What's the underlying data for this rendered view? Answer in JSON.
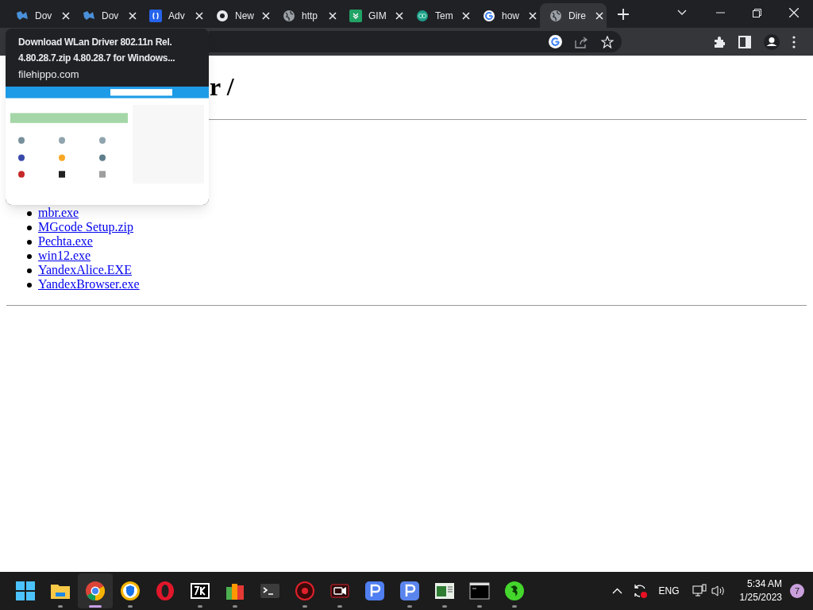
{
  "tabs": [
    {
      "title": "Dov",
      "selected": false
    },
    {
      "title": "Dov",
      "selected": false
    },
    {
      "title": "Adv",
      "selected": false
    },
    {
      "title": "New",
      "selected": false
    },
    {
      "title": "http",
      "selected": false
    },
    {
      "title": "GIM",
      "selected": false
    },
    {
      "title": "Tem",
      "selected": false
    },
    {
      "title": "how",
      "selected": false
    },
    {
      "title": "Dire",
      "selected": true
    }
  ],
  "tab_preview": {
    "title": "Download WLan Driver 802.11n Rel. 4.80.28.7.zip 4.80.28.7 for Windows...",
    "domain": "filehippo.com"
  },
  "page": {
    "heading": "r /",
    "files": [
      "mbr.exe",
      "MGcode Setup.zip",
      "Pechta.exe",
      "win12.exe",
      "YandexAlice.EXE",
      "YandexBrowser.exe"
    ]
  },
  "taskbar": {
    "apps": [
      {
        "running": false,
        "selected": false
      },
      {
        "running": true,
        "selected": false
      },
      {
        "running": true,
        "selected": true
      },
      {
        "running": true,
        "selected": false
      },
      {
        "running": false,
        "selected": false
      },
      {
        "running": true,
        "selected": false
      },
      {
        "running": true,
        "selected": false
      },
      {
        "running": false,
        "selected": false
      },
      {
        "running": true,
        "selected": false
      },
      {
        "running": true,
        "selected": false
      },
      {
        "running": false,
        "selected": false
      },
      {
        "running": true,
        "selected": false
      },
      {
        "running": true,
        "selected": false
      },
      {
        "running": true,
        "selected": false
      },
      {
        "running": true,
        "selected": false
      }
    ],
    "language": "ENG",
    "time": "5:34 AM",
    "date": "1/25/2023",
    "notifications": "7"
  }
}
